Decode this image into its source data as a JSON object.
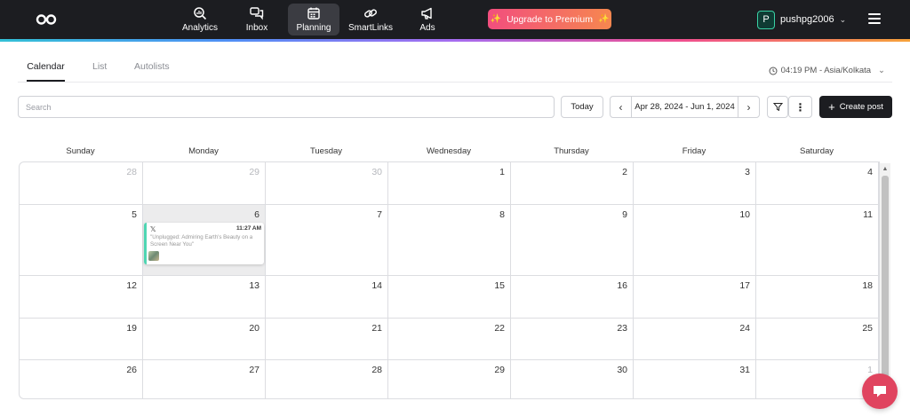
{
  "nav": {
    "items": [
      {
        "label": "Analytics",
        "icon": "analytics-search-icon"
      },
      {
        "label": "Inbox",
        "icon": "chat-bubbles-icon"
      },
      {
        "label": "Planning",
        "icon": "calendar-icon",
        "active": true
      },
      {
        "label": "SmartLinks",
        "icon": "link-icon"
      },
      {
        "label": "Ads",
        "icon": "megaphone-icon"
      }
    ],
    "upgrade_label": "Upgrade to Premium",
    "account": {
      "initial": "P",
      "username": "pushpg2006"
    }
  },
  "tabs": [
    "Calendar",
    "List",
    "Autolists"
  ],
  "timezone": "04:19 PM - Asia/Kolkata",
  "toolbar": {
    "search_placeholder": "Search",
    "today_label": "Today",
    "date_range": "Apr 28, 2024 - Jun 1, 2024",
    "create_label": "Create post"
  },
  "calendar": {
    "weekdays": [
      "Sunday",
      "Monday",
      "Tuesday",
      "Wednesday",
      "Thursday",
      "Friday",
      "Saturday"
    ],
    "weeks": [
      [
        "28",
        "29",
        "30",
        "1",
        "2",
        "3",
        "4"
      ],
      [
        "5",
        "6",
        "7",
        "8",
        "9",
        "10",
        "11"
      ],
      [
        "12",
        "13",
        "14",
        "15",
        "16",
        "17",
        "18"
      ],
      [
        "19",
        "20",
        "21",
        "22",
        "23",
        "24",
        "25"
      ],
      [
        "26",
        "27",
        "28",
        "29",
        "30",
        "31",
        "1"
      ]
    ],
    "outside_month": [
      [
        0,
        0
      ],
      [
        0,
        1
      ],
      [
        0,
        2
      ],
      [
        4,
        6
      ]
    ],
    "highlighted": [
      1,
      1
    ],
    "post": {
      "week": 1,
      "day": 1,
      "platform_icon": "x-logo-icon",
      "time": "11:27 AM",
      "caption": "\"Unplugged: Admiring Earth's Beauty on a Screen Near You\""
    }
  },
  "colors": {
    "accent_post": "#4fd6b3",
    "upgrade_start": "#f24e7e",
    "upgrade_end": "#f6874f",
    "chat": "#e0445f",
    "topbar": "#1c1d21"
  }
}
